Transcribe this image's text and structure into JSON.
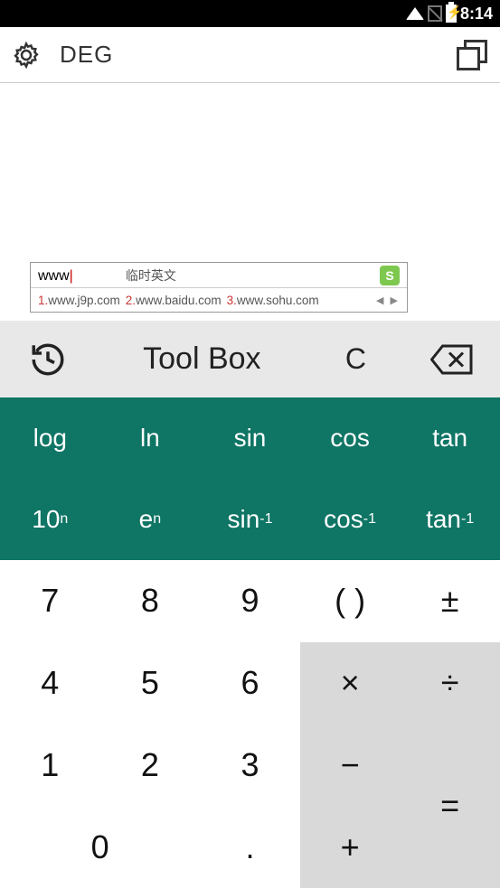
{
  "status": {
    "time": "8:14"
  },
  "header": {
    "mode": "DEG"
  },
  "ime": {
    "typed": "www",
    "hint": "临时英文",
    "logo": "S",
    "suggestions": [
      {
        "idx": "1.",
        "text": "www.j9p.com"
      },
      {
        "idx": "2.",
        "text": "www.baidu.com"
      },
      {
        "idx": "3.",
        "text": "www.sohu.com"
      }
    ],
    "arrows": "◀ ▶"
  },
  "toolbar": {
    "toolbox": "Tool Box",
    "clear": "C"
  },
  "sci1": {
    "log": "log",
    "ln": "ln",
    "sin": "sin",
    "cos": "cos",
    "tan": "tan"
  },
  "sci2": {
    "tenn": "10",
    "en": "e",
    "sinv": "sin",
    "cinv": "cos",
    "tinv": "tan",
    "sup_n": "n",
    "sup_inv": "-1"
  },
  "keys": {
    "7": "7",
    "8": "8",
    "9": "9",
    "paren": "( )",
    "pm": "±",
    "4": "4",
    "5": "5",
    "6": "6",
    "mul": "×",
    "div": "÷",
    "1": "1",
    "2": "2",
    "3": "3",
    "sub": "−",
    "eq": "=",
    "0": "0",
    "dot": ".",
    "add": "+"
  }
}
